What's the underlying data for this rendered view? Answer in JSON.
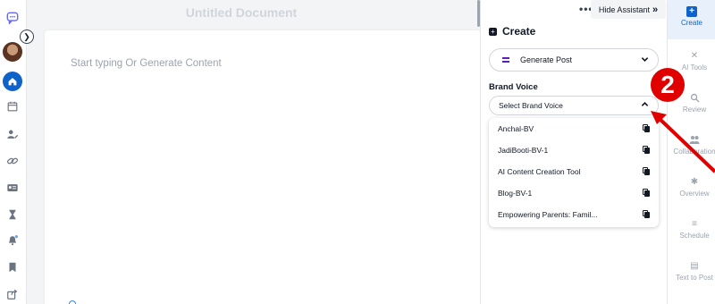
{
  "editor": {
    "title": "Untitled Document",
    "placeholder": "Start typing Or Generate Content"
  },
  "assistant": {
    "more_label": "•••",
    "hide_label": "Hide Assistant",
    "hide_icon": "»",
    "create_title": "Create",
    "post_type": {
      "value": "Generate Post",
      "chevron": "⌄"
    },
    "brand_voice": {
      "label": "Brand Voice",
      "placeholder": "Select Brand Voice",
      "chevron": "^",
      "options": [
        "Anchal-BV",
        "JadiBooti-BV-1",
        "AI Content Creation Tool",
        "Blog-BV-1",
        "Empowering Parents: Famil..."
      ]
    }
  },
  "annotation": {
    "step_number": "2",
    "color": "#e00000"
  },
  "tools": [
    {
      "label": "Create",
      "icon": "plus-square-icon",
      "glyph": "+",
      "active": true
    },
    {
      "label": "AI Tools",
      "icon": "tools-icon",
      "glyph": "✕",
      "active": false
    },
    {
      "label": "Review",
      "icon": "magnifier-icon",
      "glyph": "⌕",
      "active": false
    },
    {
      "label": "Collaboration",
      "icon": "people-icon",
      "glyph": "👥",
      "active": false
    },
    {
      "label": "Overview",
      "icon": "asterisk-icon",
      "glyph": "✱",
      "active": false
    },
    {
      "label": "Schedule",
      "icon": "schedule-icon",
      "glyph": "≡",
      "active": false
    },
    {
      "label": "Text to Post",
      "icon": "text-to-post-icon",
      "glyph": "▤",
      "active": false
    }
  ],
  "colors": {
    "accent": "#0f62c9",
    "brand_purple": "#5b21b6"
  }
}
